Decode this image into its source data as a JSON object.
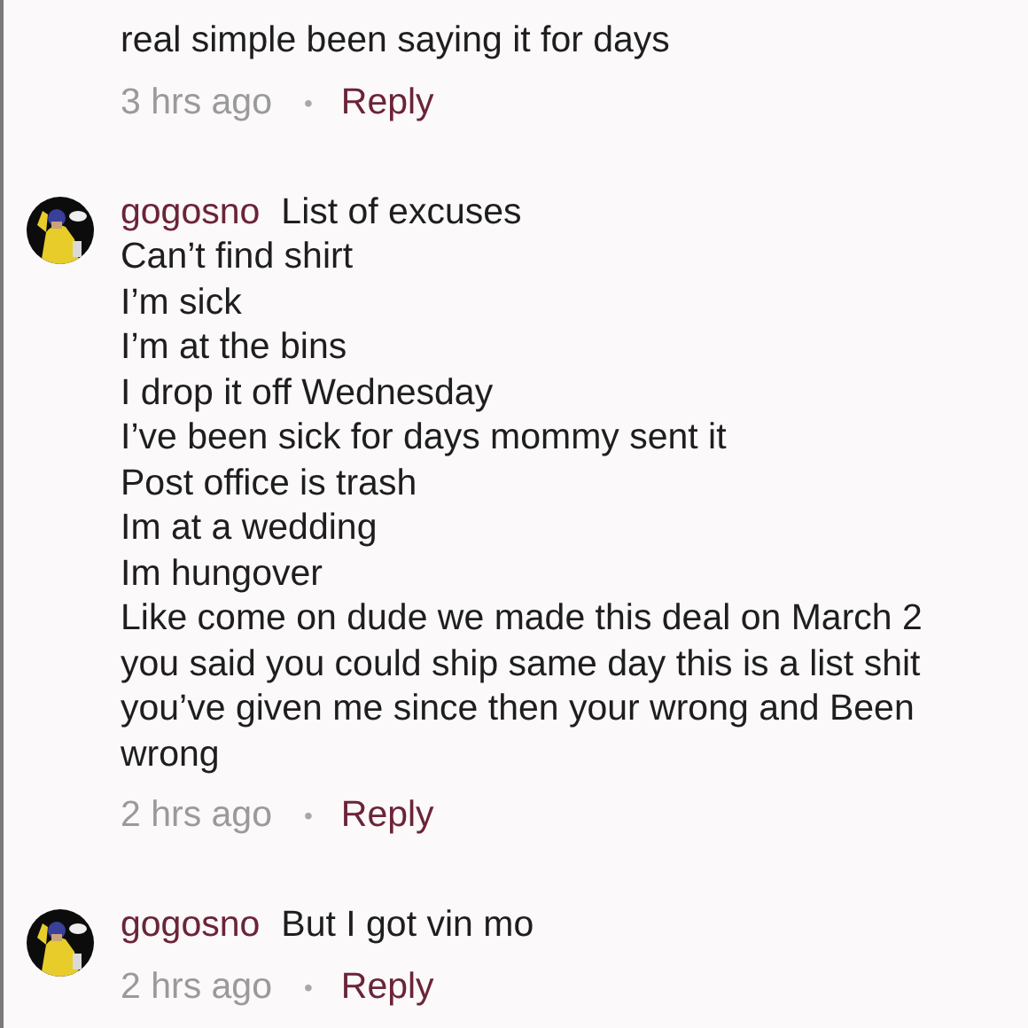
{
  "top_comment": {
    "lines": [
      "real simple been saying it for days"
    ],
    "time": "3 hrs ago",
    "separator": "•",
    "reply": "Reply"
  },
  "comments": [
    {
      "author": "gogosno",
      "first_line": "List of excuses",
      "lines": [
        "Can’t find shirt",
        "I’m sick",
        "I’m at the bins",
        "I drop it off Wednesday",
        "I’ve been sick for days mommy sent it",
        "Post office is trash",
        "Im at a wedding",
        "Im hungover",
        "Like come on dude we made this deal on March 2",
        "you said you could ship same day this is a list shit",
        "you’ve given me since then your wrong and Been",
        "wrong"
      ],
      "time": "2 hrs ago",
      "separator": "•",
      "reply": "Reply"
    },
    {
      "author": "gogosno",
      "first_line": "But I got vin mo",
      "time": "2 hrs ago",
      "separator": "•",
      "reply": "Reply"
    }
  ]
}
